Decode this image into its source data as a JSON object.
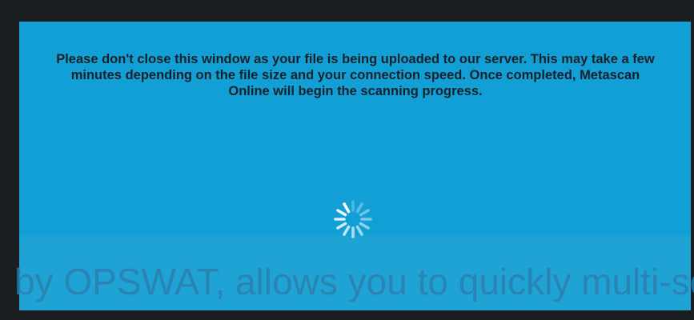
{
  "background": {
    "text": "by OPSWAT, allows you to quickly multi-sca"
  },
  "modal": {
    "message": "Please don't close this window as your file is being uploaded to our server. This may take a few minutes depending on the file size and your connection speed. Once completed, Metascan Online will begin the scanning progress.",
    "spinner_icon": "loading-spinner-icon",
    "colors": {
      "modal_bg": "#129fd5",
      "modal_lower_bg": "#1ea3d4",
      "text": "#16212a",
      "page_bg": "#1b1e21"
    }
  }
}
